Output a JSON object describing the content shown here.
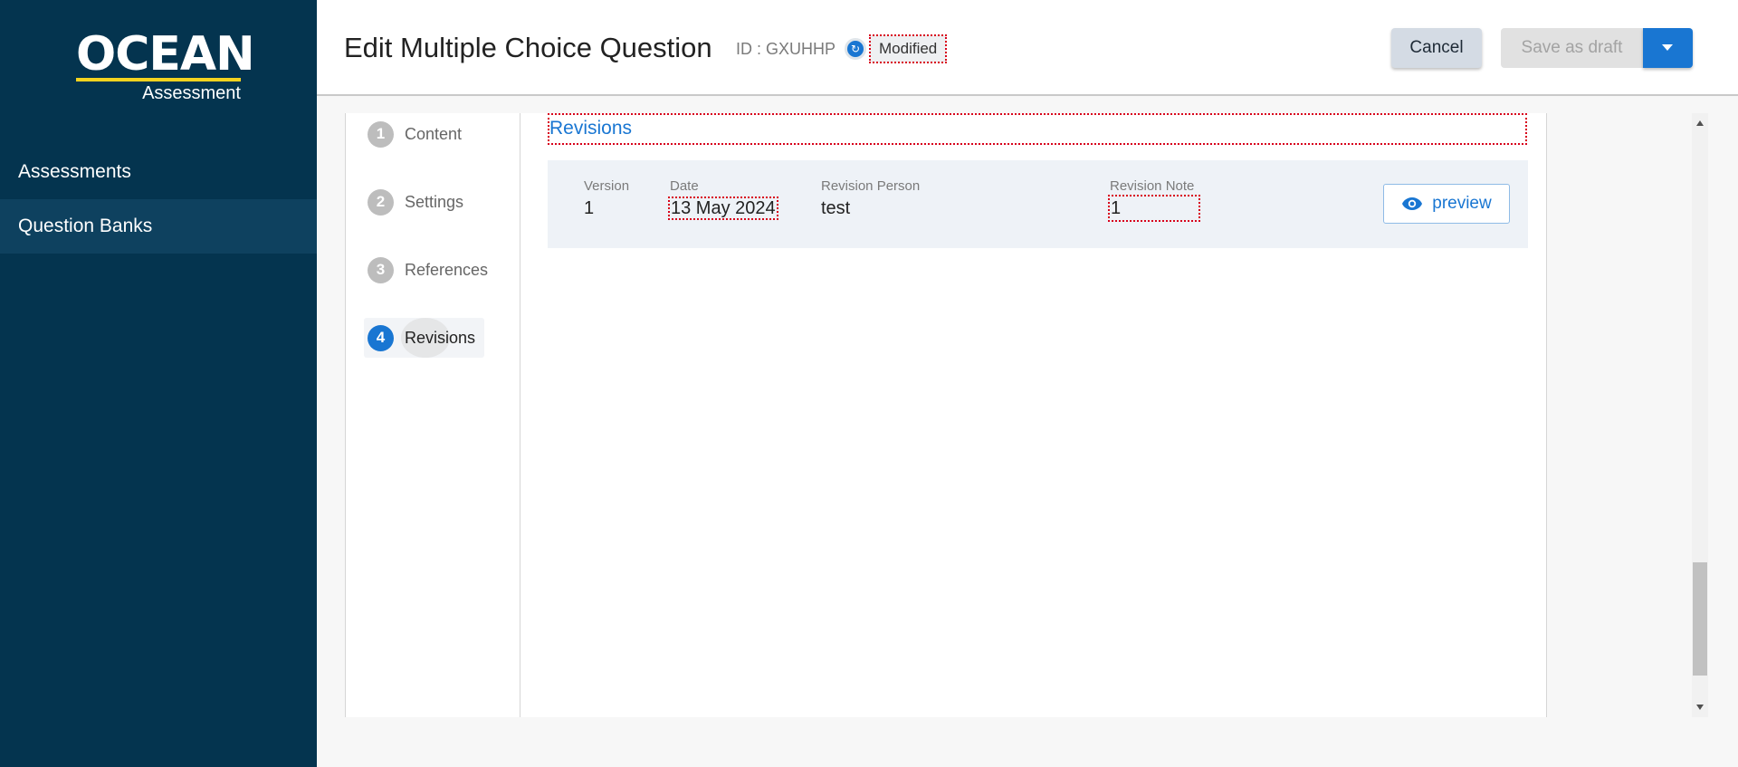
{
  "brand": {
    "logo_main": "OCEAN",
    "logo_sub": "Assessment",
    "accent_color": "#f4d31f",
    "primary_color": "#1976d2",
    "sidebar_color": "#04344f"
  },
  "sidebar": {
    "items": [
      {
        "label": "Assessments",
        "active": false
      },
      {
        "label": "Question Banks",
        "active": true
      }
    ]
  },
  "header": {
    "title": "Edit Multiple Choice Question",
    "id_text": "ID : GXUHHP",
    "status": "Modified",
    "status_icon": "sync-icon",
    "cancel_label": "Cancel",
    "save_label": "Save as draft",
    "dropdown_icon": "caret-down-icon"
  },
  "steps": [
    {
      "number": "1",
      "label": "Content",
      "active": false
    },
    {
      "number": "2",
      "label": "Settings",
      "active": false
    },
    {
      "number": "3",
      "label": "References",
      "active": false
    },
    {
      "number": "4",
      "label": "Revisions",
      "active": true
    }
  ],
  "revisions": {
    "title": "Revisions",
    "columns": {
      "version": "Version",
      "date": "Date",
      "person": "Revision Person",
      "note": "Revision Note"
    },
    "rows": [
      {
        "version": "1",
        "date": "13 May 2024",
        "person": "test",
        "note": "1",
        "action_label": "preview",
        "action_icon": "eye-icon"
      }
    ]
  }
}
